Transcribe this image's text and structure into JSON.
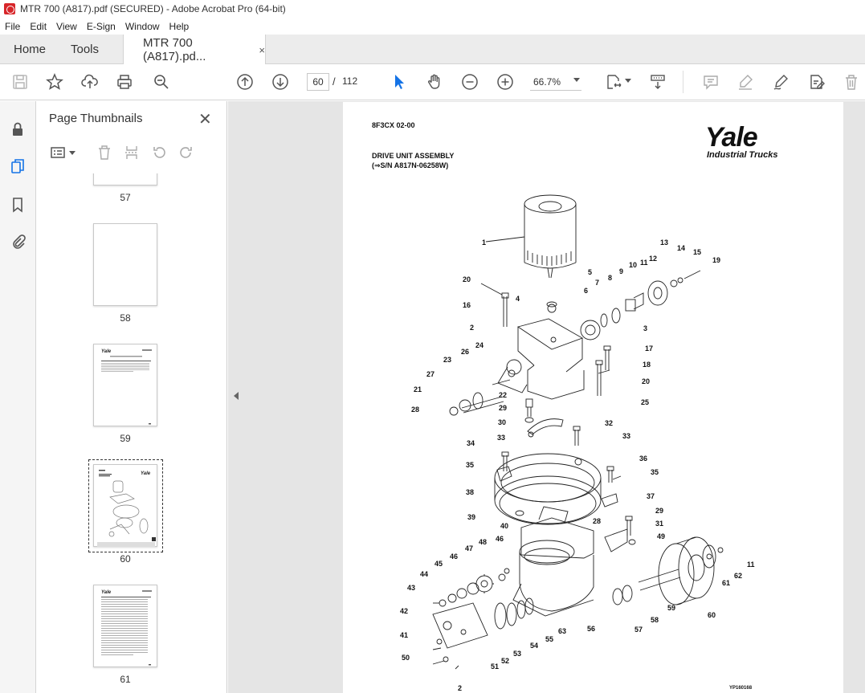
{
  "window": {
    "title": "MTR 700 (A817).pdf (SECURED) - Adobe Acrobat Pro (64-bit)"
  },
  "menu": [
    "File",
    "Edit",
    "View",
    "E-Sign",
    "Window",
    "Help"
  ],
  "tabs": {
    "home": "Home",
    "tools": "Tools",
    "doc": "MTR 700 (A817).pd...",
    "doc_close": "×"
  },
  "toolbar": {
    "page_current": "60",
    "page_sep": "/",
    "page_total": "112",
    "zoom": "66.7%"
  },
  "panel": {
    "title": "Page Thumbnails",
    "close": "✕",
    "thumbnails": [
      "57",
      "58",
      "59",
      "60",
      "61"
    ],
    "selected": "60"
  },
  "page": {
    "code": "8F3CX     02-00",
    "title_line1": "DRIVE UNIT ASSEMBLY",
    "title_line2": "(⇒S/N A817N-06258W)",
    "logo": "Yale",
    "logo_sub": "Industrial Trucks",
    "fig_code": "YP160168"
  },
  "callouts": [
    "1",
    "5",
    "6",
    "7",
    "8",
    "9",
    "10",
    "11",
    "12",
    "13",
    "14",
    "15",
    "19",
    "20",
    "16",
    "4",
    "2",
    "3",
    "17",
    "18",
    "20",
    "25",
    "26",
    "24",
    "23",
    "27",
    "22",
    "21",
    "28",
    "29",
    "30",
    "33",
    "32",
    "33",
    "34",
    "36",
    "35",
    "35",
    "37",
    "38",
    "39",
    "40",
    "28",
    "29",
    "31",
    "49",
    "46",
    "48",
    "47",
    "46",
    "45",
    "44",
    "43",
    "42",
    "41",
    "50",
    "51",
    "52",
    "53",
    "54",
    "55",
    "63",
    "56",
    "57",
    "58",
    "59",
    "60",
    "61",
    "62",
    "11",
    "2"
  ],
  "colors": {
    "accent": "#1473e6",
    "logo_red": "#d7262a"
  }
}
